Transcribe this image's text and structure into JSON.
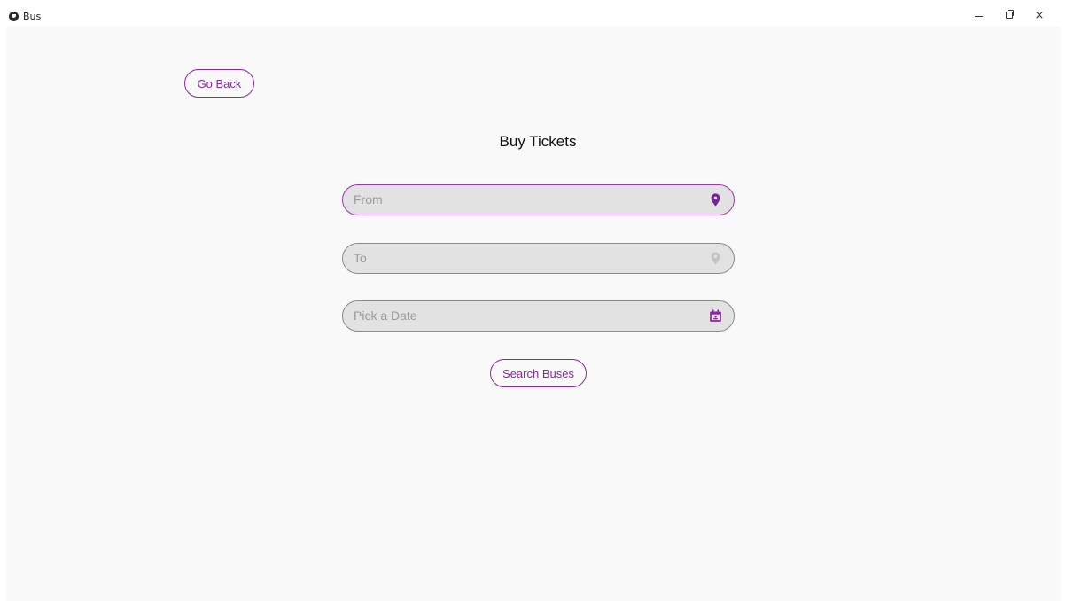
{
  "window": {
    "title": "Bus",
    "controls": {
      "minimize": "minimize-icon",
      "maximize": "restore-icon",
      "close": "×"
    }
  },
  "nav": {
    "back_label": "Go Back"
  },
  "page": {
    "title": "Buy Tickets"
  },
  "form": {
    "from": {
      "placeholder": "From",
      "icon": "map-marker-icon",
      "icon_color": "#7b1fa2"
    },
    "to": {
      "placeholder": "To",
      "icon": "map-marker-icon",
      "icon_color": "#c4c4c4"
    },
    "date": {
      "placeholder": "Pick a Date",
      "icon": "calendar-icon",
      "icon_color": "#8e24aa"
    },
    "submit_label": "Search Buses"
  },
  "colors": {
    "accent": "#8e24aa",
    "field_bg": "#e2e2e2",
    "content_bg": "#f9f9f9"
  }
}
